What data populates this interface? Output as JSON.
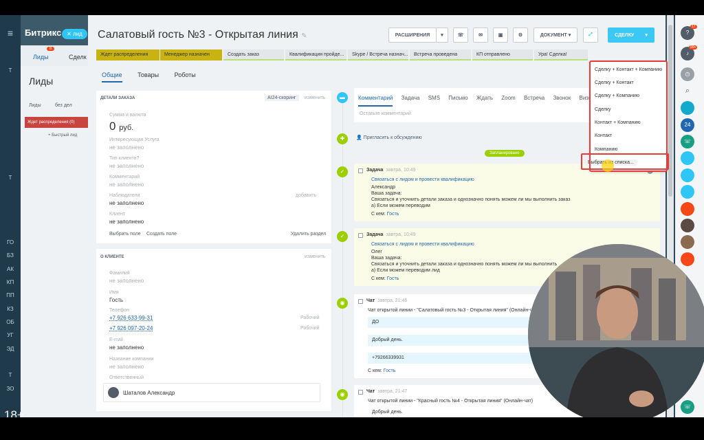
{
  "left_nav": {
    "brand": "Битрикс",
    "tag": "лид",
    "items": [
      "Т",
      "Т",
      "ГО",
      "БЗ",
      "АК",
      "КП",
      "ПП",
      "КЗ",
      "ОБ",
      "УГ",
      "ЭД",
      "Т",
      "ЗО"
    ]
  },
  "bg": {
    "tab_leads": "Лиды",
    "tab_deals": "Сделк",
    "leads_badge": "8",
    "page_title": "Лиды",
    "filter_leads": "Лиды",
    "filter_nodeal": "без дел",
    "stage_col": "Ждет распределения",
    "stage_count": "(0)",
    "quick_lead": "+ Быстрый лид"
  },
  "header": {
    "title": "Салатовый гость №3 - Открытая линия",
    "btn_ext": "РАСШИРЕНИЯ",
    "btn_doc": "ДОКУМЕНТ",
    "btn_deal": "СДЕЛКУ"
  },
  "stages": [
    "Ждет распределения",
    "Менеджер назначен",
    "Создать заказ",
    "Квалификация пройде...",
    "Skype / Встреча назнач...",
    "Встреча проведена",
    "КП отправлено",
    "Ура! Сделка!"
  ],
  "subtabs": [
    "Общие",
    "Товары",
    "Роботы"
  ],
  "order": {
    "heading": "ДЕТАЛИ ЗАКАЗА",
    "scoring": "AI24-скоринг",
    "edit": "изменить",
    "sum_label": "Сумма и валюта",
    "sum": "0",
    "currency": "руб.",
    "service_label": "Интересующая Услуга",
    "client_type_label": "Тип клиента?",
    "comment_label": "Комментарий",
    "observers_label": "Наблюдатели",
    "add": "добавить",
    "client_label": "Клиент",
    "empty": "не заполнено",
    "choose_field": "Выбрать поле",
    "create_field": "Создать поле",
    "delete_section": "Удалить раздел"
  },
  "about": {
    "heading": "О КЛИЕНТЕ",
    "edit": "изменить",
    "surname_label": "Фамилия",
    "name_label": "Имя",
    "name": "Гость",
    "phone_label": "Телефон",
    "phone1": "+7 926 633-99-31",
    "phone2": "+7 926 097-20-24",
    "phone_type": "Рабочий",
    "email_label": "E-mail",
    "company_label": "Название компании",
    "resp_label": "Ответственный",
    "resp": "Шаталов Александр",
    "empty": "не заполнено"
  },
  "timeline": {
    "tabs": [
      "Комментарий",
      "Задача",
      "SMS",
      "Письмо",
      "Ждать",
      "Zoom",
      "Встреча",
      "Звонок",
      "Визи"
    ],
    "comment_placeholder": "Оставьте комментарий",
    "invite": "Пригласить к обсуждению",
    "planned": "Запланировано",
    "task1": {
      "title": "Задача",
      "time": "завтра, 10:49",
      "link": "Связаться с лидом и провести квалификацию",
      "person": "Александр",
      "l1": "Ваша задача:",
      "l2": "Связаться и уточнить детали заказа и однозначно понять можем ли мы выполнить заказ",
      "l3": "а) Если можем переводим",
      "with": "С кем:",
      "guest": "Гость"
    },
    "task2": {
      "title": "Задача",
      "time": "завтра, 10:49",
      "link": "Связаться с лидом и провести квалификацию",
      "person": "Олег",
      "l1": "Ваша задача:",
      "l2": "Связаться и уточнить детали заказа и однозначно понять можем ли мы выполнить",
      "l3": "а) Если можем переводим лид",
      "with": "С кем:",
      "guest": "Гость"
    },
    "chat1": {
      "title": "Чат",
      "time": "завтра, 21:46",
      "link": "Чат открытой линии - \"Салатовый гость №3 - Открытая линия\" (Онлайн-ч",
      "m1": "ДО",
      "m2": "Добрый день.",
      "m3": "+79266339931",
      "with": "С кем:",
      "guest": "Гость"
    },
    "chat2": {
      "title": "Чат",
      "time": "завтра, 21:47",
      "link": "Чат открытой линии - \"Красный гость №4 - Открытая линия\" (Онлайн-чат)",
      "m1": "Добрый день."
    }
  },
  "dropdown": [
    "Сделку + Контакт + Компанию",
    "Сделку + Контакт",
    "Сделку + Компанию",
    "Сделку",
    "Контакт + Компанию",
    "Контакт",
    "Компанию",
    "Выбрать из списка..."
  ],
  "rightbar": {
    "badge1": "17",
    "badge2": "99+",
    "num": "24"
  },
  "rating": "18+",
  "colors": {
    "accent": "#3bc8f5",
    "stage_done": "#c9b312",
    "highlight": "#e63c3c",
    "green": "#9dcf00"
  }
}
